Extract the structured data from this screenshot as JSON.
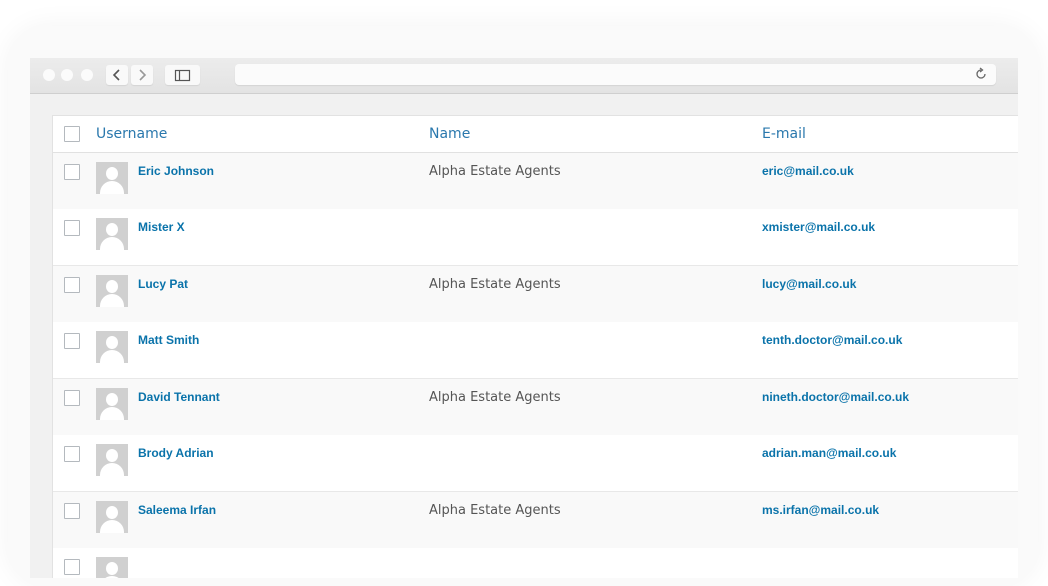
{
  "browser": {
    "address_value": ""
  },
  "table": {
    "columns": {
      "username": "Username",
      "name": "Name",
      "email": "E-mail"
    },
    "rows": [
      {
        "username": "Eric Johnson",
        "name": "Alpha Estate Agents",
        "email": "eric@mail.co.uk"
      },
      {
        "username": "Mister X",
        "name": "",
        "email": "xmister@mail.co.uk"
      },
      {
        "username": "Lucy Pat",
        "name": "Alpha Estate Agents",
        "email": "lucy@mail.co.uk"
      },
      {
        "username": "Matt Smith",
        "name": "",
        "email": "tenth.doctor@mail.co.uk"
      },
      {
        "username": "David Tennant",
        "name": "Alpha Estate Agents",
        "email": "nineth.doctor@mail.co.uk"
      },
      {
        "username": "Brody Adrian",
        "name": "",
        "email": "adrian.man@mail.co.uk"
      },
      {
        "username": "Saleema Irfan",
        "name": "Alpha Estate Agents",
        "email": "ms.irfan@mail.co.uk"
      }
    ]
  },
  "colors": {
    "link": "#0a73aa",
    "header_link": "#2a78ad",
    "text": "#555555"
  },
  "icons": [
    "back-icon",
    "forward-icon",
    "sidebar-icon",
    "reload-icon",
    "avatar-placeholder-icon"
  ]
}
